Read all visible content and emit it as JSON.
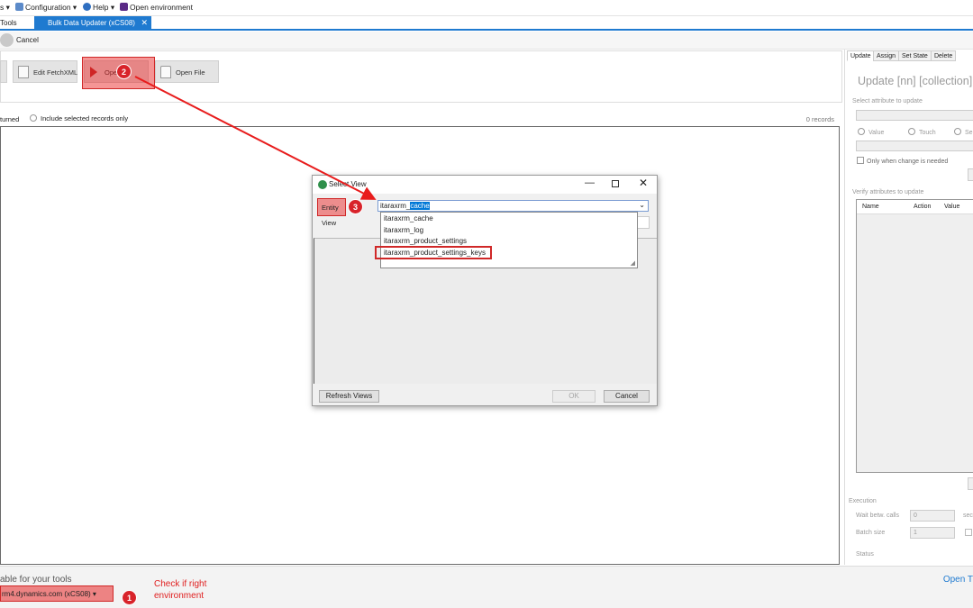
{
  "menu": {
    "tools_prefix": "s ▾",
    "configuration": "Configuration ▾",
    "help": "Help ▾",
    "open_environment": "Open environment"
  },
  "tabs": {
    "tools": "Tools",
    "active": "Bulk Data Updater (xCS08)",
    "close": "✕"
  },
  "toolbar": {
    "cancel": "Cancel",
    "edit_fetchxml": "Edit FetchXML",
    "open_view": "Open",
    "open_file": "Open File"
  },
  "options": {
    "returned": "turned",
    "include_selected": "Include selected records only",
    "records": "0 records"
  },
  "right_panel": {
    "tabs": [
      "Update",
      "Assign",
      "Set State",
      "Delete"
    ],
    "heading": "Update [nn] [collection]",
    "select_attr": "Select attribute to update",
    "radio_value": "Value",
    "radio_touch": "Touch",
    "radio_set": "Se",
    "only_when_changed": "Only when change is needed",
    "verify_attrs": "Verify attributes to update",
    "col_name": "Name",
    "col_action": "Action",
    "col_value": "Value",
    "execution": "Execution",
    "wait_calls": "Wait betw. calls",
    "wait_value": "0",
    "wait_unit": "sec",
    "batch_size": "Batch size",
    "batch_value": "1",
    "status": "Status"
  },
  "dialog": {
    "title": "Select View",
    "entity_label": "Entity",
    "view_label": "View",
    "entity_value_prefix": "itaraxrm_",
    "entity_value_selected": "cache",
    "options": [
      "itaraxrm_cache",
      "itaraxrm_log",
      "itaraxrm_product_settings",
      "itaraxrm_product_settings_keys"
    ],
    "refresh_views": "Refresh Views",
    "ok": "OK",
    "cancel": "Cancel"
  },
  "bottom": {
    "label": "able for your tools",
    "environment": "rm4.dynamics.com (xCS08) ▾",
    "open_tools": "Open T"
  },
  "annotations": {
    "badge1": "1",
    "badge2": "2",
    "badge3": "3",
    "note_line1": "Check if right",
    "note_line2": "environment"
  },
  "colors": {
    "accent": "#1f7ad0",
    "annotation_red": "#d8232a"
  }
}
